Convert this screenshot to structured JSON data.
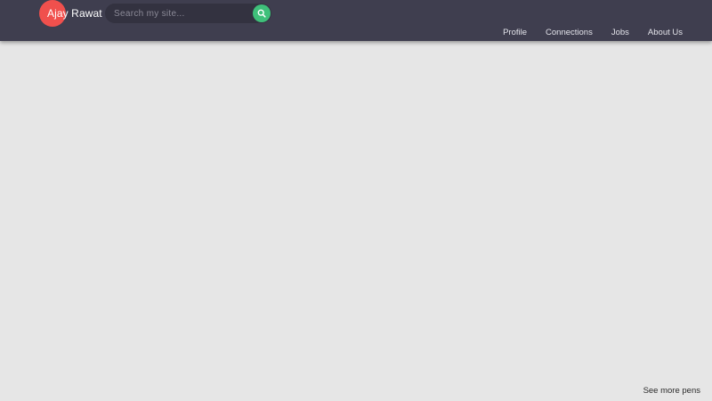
{
  "brand": {
    "name": "Ajay Rawat",
    "accent": "#f0504d"
  },
  "search": {
    "placeholder": "Search my site...",
    "icon": "search-icon",
    "button_color": "#3fc07a"
  },
  "nav": {
    "items": [
      {
        "label": "Profile"
      },
      {
        "label": "Connections"
      },
      {
        "label": "Jobs"
      },
      {
        "label": "About Us"
      }
    ]
  },
  "footer": {
    "link_label": "See more pens"
  },
  "colors": {
    "navbar": "#3f3e4f",
    "background": "#e6e6e6"
  }
}
